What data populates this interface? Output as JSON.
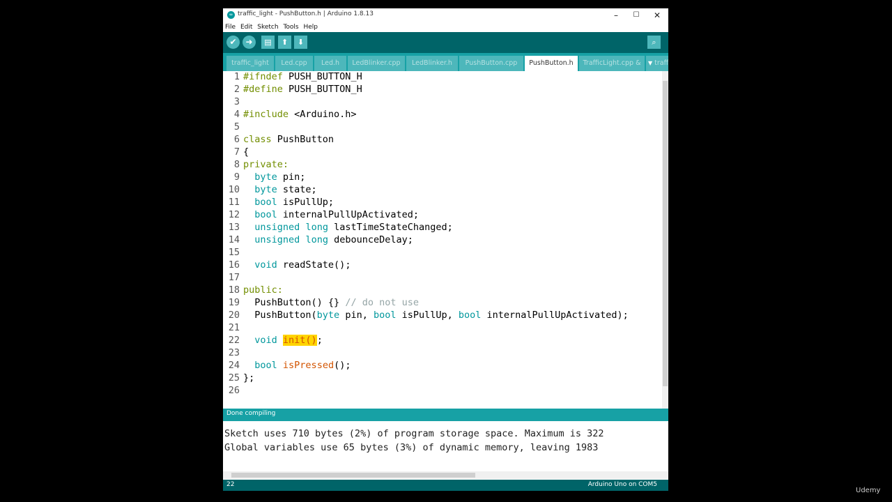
{
  "window": {
    "title": "traffic_light - PushButton.h | Arduino 1.8.13",
    "controls": {
      "minimize": "–",
      "maximize": "☐",
      "close": "✕"
    }
  },
  "menu": [
    "File",
    "Edit",
    "Sketch",
    "Tools",
    "Help"
  ],
  "toolbar": {
    "verify_icon": "check-icon",
    "upload_icon": "arrow-right-icon",
    "new_icon": "new-file-icon",
    "open_icon": "open-arrow-up-icon",
    "save_icon": "save-arrow-down-icon",
    "serial_icon": "magnifier-icon"
  },
  "tabs": [
    {
      "label": "traffic_light",
      "active": false
    },
    {
      "label": "Led.cpp",
      "active": false
    },
    {
      "label": "Led.h",
      "active": false
    },
    {
      "label": "LedBlinker.cpp",
      "active": false
    },
    {
      "label": "LedBlinker.h",
      "active": false
    },
    {
      "label": "PushButton.cpp",
      "active": false
    },
    {
      "label": "PushButton.h",
      "active": true
    },
    {
      "label": "TrafficLight.cpp &",
      "active": false
    },
    {
      "label": "traffic",
      "active": false
    }
  ],
  "tabs_overflow": "▼",
  "line_numbers": [
    "1",
    "2",
    "3",
    "4",
    "5",
    "6",
    "7",
    "8",
    "9",
    "10",
    "11",
    "12",
    "13",
    "14",
    "15",
    "16",
    "17",
    "18",
    "19",
    "20",
    "21",
    "22",
    "23",
    "24",
    "25",
    "26"
  ],
  "code": {
    "l1a": "#ifndef",
    "l1b": " PUSH_BUTTON_H",
    "l2a": "#define",
    "l2b": " PUSH_BUTTON_H",
    "l4a": "#include",
    "l4b": " <Arduino.h>",
    "l6a": "class",
    "l6b": " PushButton",
    "l7": "{",
    "l8": "private:",
    "l9a": "byte",
    "l9b": " pin;",
    "l10a": "byte",
    "l10b": " state;",
    "l11a": "bool",
    "l11b": " isPullUp;",
    "l12a": "bool",
    "l12b": " internalPullUpActivated;",
    "l13a": "unsigned",
    "l13b": "long",
    "l13c": " lastTimeStateChanged;",
    "l14a": "unsigned",
    "l14b": "long",
    "l14c": " debounceDelay;",
    "l16a": "void",
    "l16b": " readState();",
    "l18": "public:",
    "l19a": "PushButton() {} ",
    "l19b": "// do not use",
    "l20a": "PushButton(",
    "l20b": "byte",
    "l20c": " pin, ",
    "l20d": "bool",
    "l20e": " isPullUp, ",
    "l20f": "bool",
    "l20g": " internalPullUpActivated);",
    "l22a": "void",
    "l22b": "init()",
    "l22c": ";",
    "l24a": "bool",
    "l24b": "isPressed",
    "l24c": "();",
    "l25": "};"
  },
  "status": "Done compiling",
  "console": [
    "Sketch uses 710 bytes (2%) of program storage space. Maximum is 322",
    "Global variables use 65 bytes (3%) of dynamic memory, leaving 1983"
  ],
  "footer": {
    "line": "22",
    "board": "Arduino Uno on COM5"
  },
  "watermark": "Udemy",
  "colors": {
    "toolbar": "#006468",
    "tabbar": "#17a1a5",
    "tab": "#4db7bb",
    "keyword": "#00979c",
    "highlight": "#ffd400"
  }
}
